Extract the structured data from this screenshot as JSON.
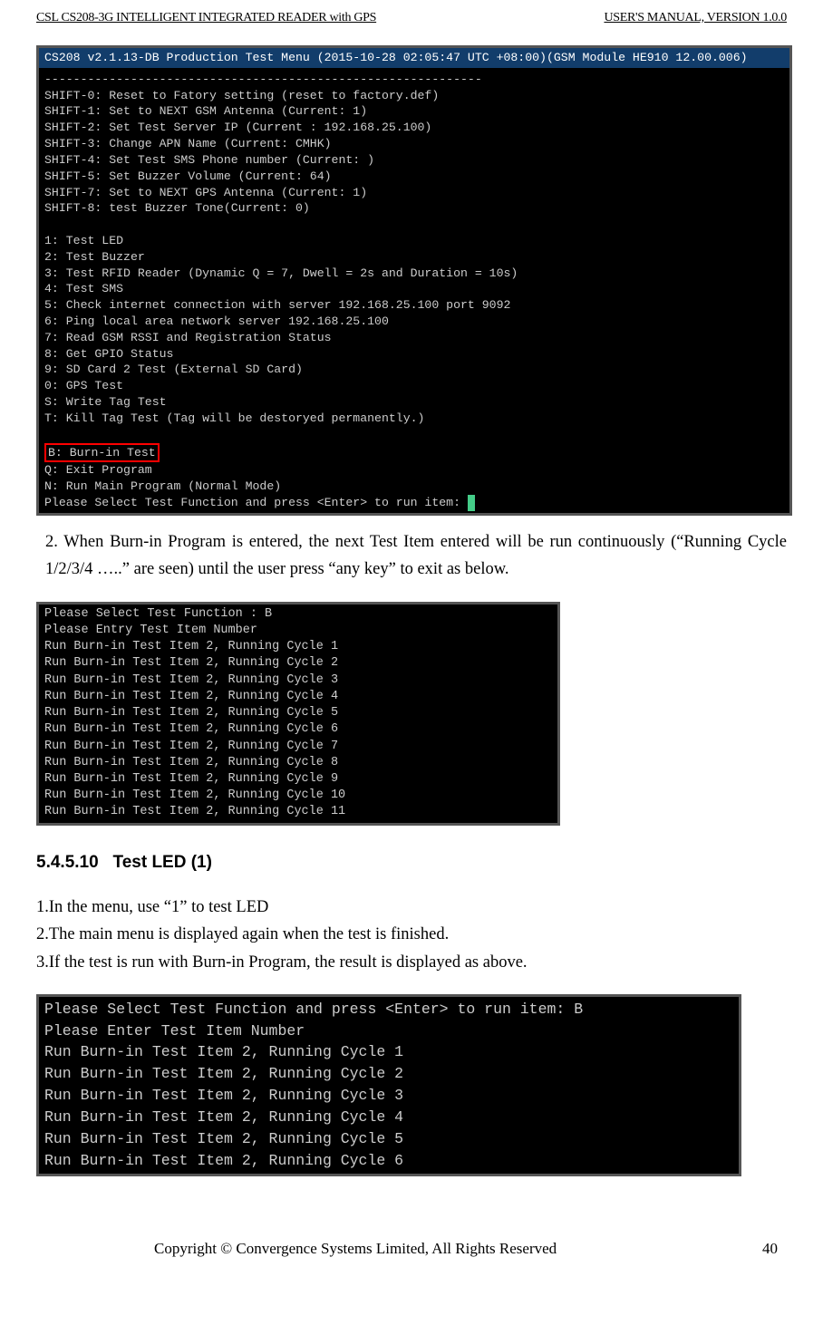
{
  "header": {
    "left": "CSL CS208-3G INTELLIGENT INTEGRATED READER with GPS",
    "right": "USER'S  MANUAL,  VERSION  1.0.0"
  },
  "terminal1": {
    "title": "CS208 v2.1.13-DB Production Test Menu (2015-10-28 02:05:47 UTC +08:00)(GSM Module HE910 12.00.006)",
    "lines_a": "-------------------------------------------------------------\nSHIFT-0: Reset to Fatory setting (reset to factory.def)\nSHIFT-1: Set to NEXT GSM Antenna (Current: 1)\nSHIFT-2: Set Test Server IP (Current : 192.168.25.100)\nSHIFT-3: Change APN Name (Current: CMHK)\nSHIFT-4: Set Test SMS Phone number (Current: )\nSHIFT-5: Set Buzzer Volume (Current: 64)\nSHIFT-7: Set to NEXT GPS Antenna (Current: 1)\nSHIFT-8: test Buzzer Tone(Current: 0)\n\n1: Test LED\n2: Test Buzzer\n3: Test RFID Reader (Dynamic Q = 7, Dwell = 2s and Duration = 10s)\n4: Test SMS\n5: Check internet connection with server 192.168.25.100 port 9092\n6: Ping local area network server 192.168.25.100\n7: Read GSM RSSI and Registration Status\n8: Get GPIO Status\n9: SD Card 2 Test (External SD Card)\n0: GPS Test\nS: Write Tag Test\nT: Kill Tag Test (Tag will be destoryed permanently.)\n",
    "highlight": "B: Burn-in Test",
    "lines_b": "Q: Exit Program\nN: Run Main Program (Normal Mode)",
    "prompt": "Please Select Test Function and press <Enter> to run item: "
  },
  "para1": {
    "text": "2.   When  Burn-in  Program  is  entered,  the  next  Test  Item  entered  will  be  run continuously (“Running Cycle 1/2/3/4 …..” are seen) until the user press “any key” to exit as below."
  },
  "terminal2": {
    "body": "Please Select Test Function : B\nPlease Entry Test Item Number\nRun Burn-in Test Item 2, Running Cycle 1\nRun Burn-in Test Item 2, Running Cycle 2\nRun Burn-in Test Item 2, Running Cycle 3\nRun Burn-in Test Item 2, Running Cycle 4\nRun Burn-in Test Item 2, Running Cycle 5\nRun Burn-in Test Item 2, Running Cycle 6\nRun Burn-in Test Item 2, Running Cycle 7\nRun Burn-in Test Item 2, Running Cycle 8\nRun Burn-in Test Item 2, Running Cycle 9\nRun Burn-in Test Item 2, Running Cycle 10\nRun Burn-in Test Item 2, Running Cycle 11"
  },
  "section": {
    "num": "5.4.5.10",
    "title": "Test LED (1)"
  },
  "list": {
    "i1": "1.In the menu, use “1” to test LED",
    "i2": "2.The main menu is displayed again when the test is finished.",
    "i3": "3.If the test is run with Burn-in Program, the result is displayed as above."
  },
  "terminal3": {
    "body": "Please Select Test Function and press <Enter> to run item: B\nPlease Enter Test Item Number\nRun Burn-in Test Item 2, Running Cycle 1\nRun Burn-in Test Item 2, Running Cycle 2\nRun Burn-in Test Item 2, Running Cycle 3\nRun Burn-in Test Item 2, Running Cycle 4\nRun Burn-in Test Item 2, Running Cycle 5\nRun Burn-in Test Item 2, Running Cycle 6"
  },
  "footer": {
    "text": "Copyright © Convergence Systems Limited, All Rights Reserved",
    "page": "40"
  }
}
